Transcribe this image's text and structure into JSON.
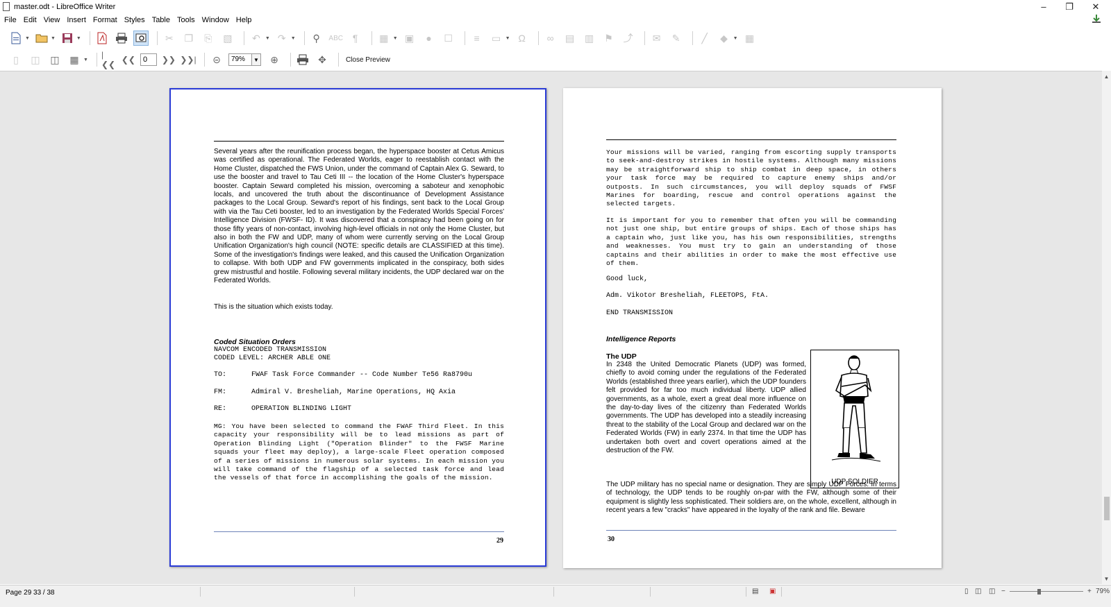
{
  "window": {
    "title": "master.odt - LibreOffice Writer"
  },
  "menu": [
    "File",
    "Edit",
    "View",
    "Insert",
    "Format",
    "Styles",
    "Table",
    "Tools",
    "Window",
    "Help"
  ],
  "preview_toolbar": {
    "page_value": "0",
    "zoom_value": "79%",
    "close_preview_label": "Close Preview"
  },
  "left_page": {
    "body": "Several years after the reunification process began, the hyperspace booster at Cetus Amicus was certified as operational. The Federated Worlds, eager to reestablish contact with the Home Cluster, dispatched the FWS Union, under the command of Captain Alex G. Seward, to use the booster and travel to Tau Ceti III -- the location of the Home Cluster's hyperspace booster. Captain Seward completed his mission, overcoming a saboteur and xenophobic locals, and uncovered the truth about the discontinuance of Development Assistance packages to the Local Group. Seward's report of his findings, sent back to the Local Group with via the Tau Ceti booster, led to an investigation by the Federated Worlds Special Forces' Intelligence Division (FWSF- ID). It was discovered that a conspiracy had been going on for those fifty years of non-contact, involving high-level officials in not only the Home Cluster, but also in both the FW and UDP, many of whom were currently serving on the Local Group Unification Organization's high council (NOTE: specific details are CLASSIFIED at this time). Some of the investigation's findings were leaked, and this caused the Unification Organization to collapse. With both UDP and FW governments implicated in the conspiracy, both sides grew mistrustful and hostile. Following several military incidents, the UDP declared war on the Federated Worlds.",
    "situation": "This is the situation which exists today.",
    "section_heading": "Coded Situation Orders",
    "transmission_line1": "NAVCOM ENCODED TRANSMISSION",
    "transmission_line2": "CODED LEVEL: ARCHER ABLE ONE",
    "to_line": "TO:      FWAF Task Force Commander -- Code Number Te56 Ra8790u",
    "fm_line": "FM:      Admiral V. Bresheliah, Marine Operations, HQ Axia",
    "re_line": "RE:      OPERATION BLINDING LIGHT",
    "mg_body": "MG:      You have been selected to command the FWAF Third Fleet. In this capacity your responsibility will be to lead missions as part of Operation Blinding Light (\"Operation Blinder\" to the FWSF Marine squads your fleet may deploy), a large-scale Fleet operation composed of a series of missions in numerous solar systems. In each mission you will take command of the flagship of a selected task force and lead the vessels of that force in accomplishing the goals of the mission.",
    "page_number": "29"
  },
  "right_page": {
    "para1": "Your missions will be varied, ranging from escorting supply transports to seek-and-destroy strikes in hostile systems. Although many missions may be straightforward ship to ship combat in deep space, in others your task force may be required to capture enemy ships and/or outposts. In such circumstances, you will deploy squads of FWSF Marines for boarding, rescue and control operations against the selected targets.",
    "para2": "It is important for you to remember that often you will be commanding not just one ship, but entire groups of ships. Each of those ships has a captain who, just like you, has his own responsibilities, strengths and weaknesses. You must try to gain an understanding of those captains and their abilities in order to make the most effective use of them.",
    "good_luck": "Good luck,",
    "signature": "Adm. Vikotor Bresheliah, FLEETOPS, FtA.",
    "end": "END TRANSMISSION",
    "section_heading": "Intelligence Reports",
    "subheading": "The UDP",
    "udp_para1": "In 2348 the United Democratic Planets (UDP) was formed, chiefly to avoid coming under the regulations of the Federated Worlds (established three years earlier), which the UDP founders felt provided for far too much individual liberty. UDP allied governments, as a whole, exert a great deal more influence on the day-to-day lives of the citizenry than Federated Worlds governments. The UDP has developed into a steadily increasing threat to the stability of the Local Group and declared war on the Federated Worlds (FW) in early 2374. In that time the UDP has undertaken both overt and covert operations aimed at the destruction of the FW.",
    "udp_para2": "The UDP military has no special name or designation. They are simply UDP Forces. In terms of technology, the UDP tends to be roughly on-par with the FW, although some of their equipment is slightly less sophisticated. Their soldiers are, on the whole, excellent, although in recent years a few \"cracks\" have appeared in the loyalty of the rank and file. Beware",
    "figure_caption": "UDP SOLDIER",
    "page_number": "30"
  },
  "status": {
    "page_info": "Page 29 33 / 38",
    "zoom_percent": "79%",
    "zoom_level": 0.79
  }
}
